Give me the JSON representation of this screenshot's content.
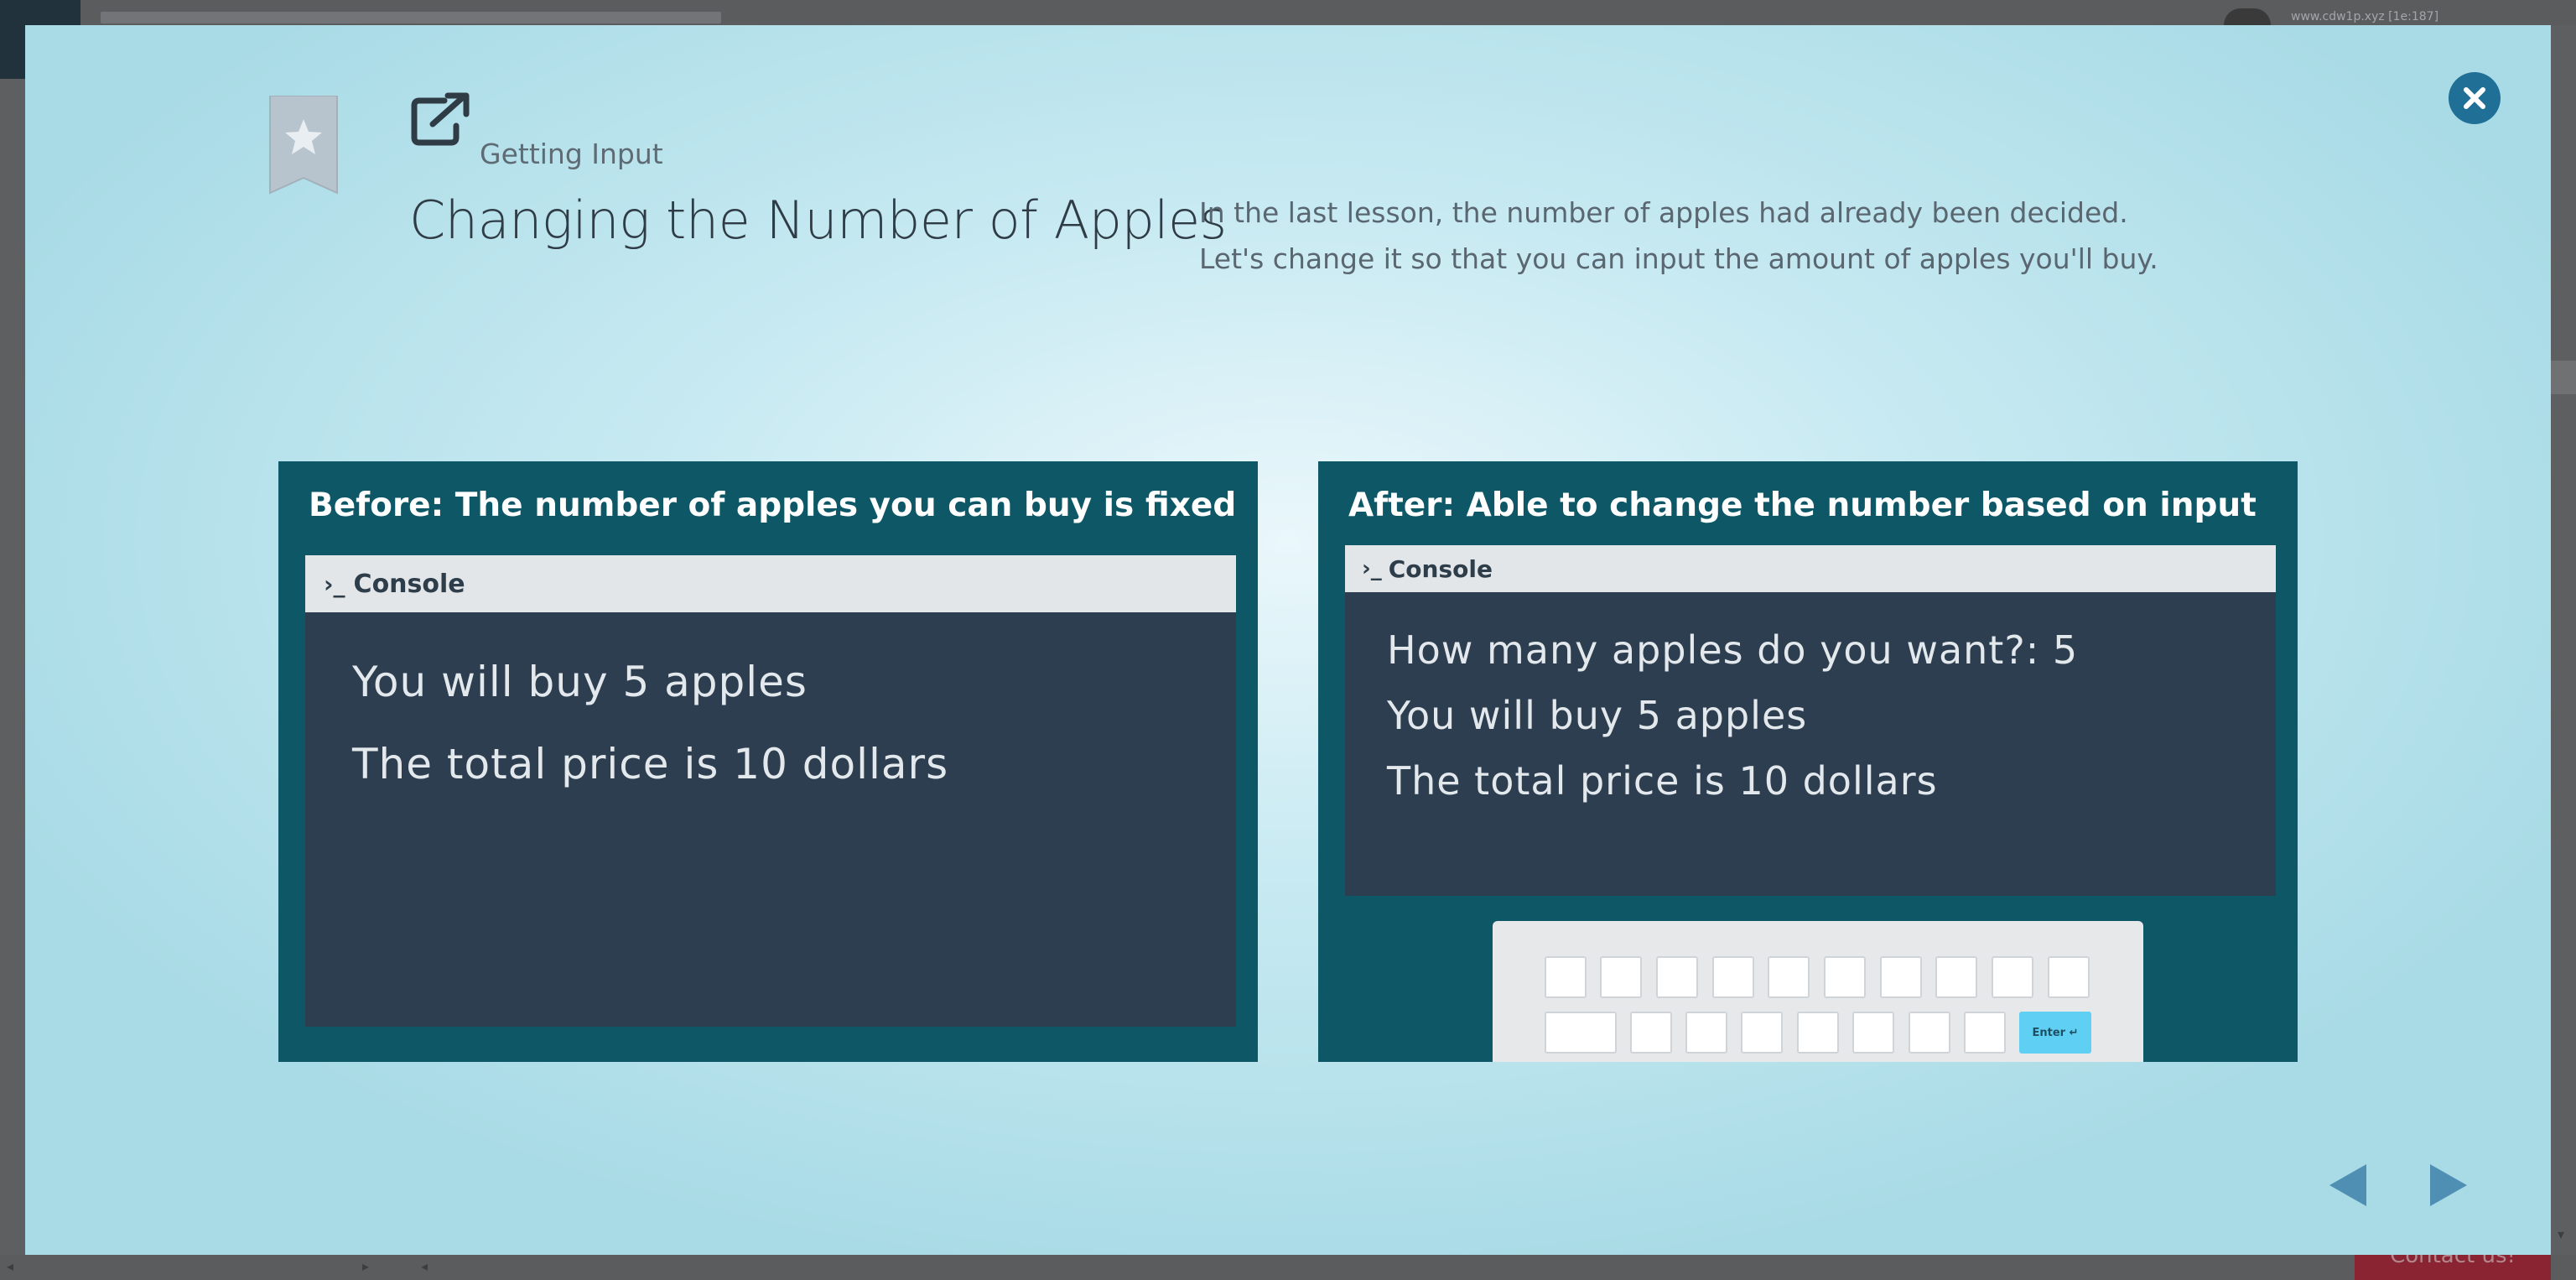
{
  "background": {
    "site_url": "www.cdw1p.xyz [1e:187]",
    "contact_label": "Contact us!"
  },
  "modal": {
    "lesson_category": "Getting Input",
    "lesson_title": "Changing the Number of Apples",
    "description": [
      "In the last lesson, the number of apples had already been decided.",
      "Let's change it so that you can input the amount of apples you'll buy."
    ],
    "icons": {
      "close": "close-icon",
      "bookmark": "bookmark-star-icon",
      "external": "external-link-icon",
      "prev": "previous-arrow-icon",
      "next": "next-arrow-icon"
    },
    "before": {
      "heading": "Before: The number of apples you can buy is fixed",
      "console_title": "Console",
      "lines": [
        "You will buy 5 apples",
        "The total price is 10 dollars"
      ]
    },
    "after": {
      "heading": "After: Able to change the number based on input",
      "console_title": "Console",
      "lines": [
        "How many apples do you want?: 5",
        "You will buy 5 apples",
        "The total price is 10 dollars"
      ],
      "enter_key": "Enter ↵"
    }
  },
  "colors": {
    "panel": "#0d5766",
    "console": "#2c3e50",
    "accent": "#1f6f96",
    "enter_key": "#5fd0f3"
  }
}
